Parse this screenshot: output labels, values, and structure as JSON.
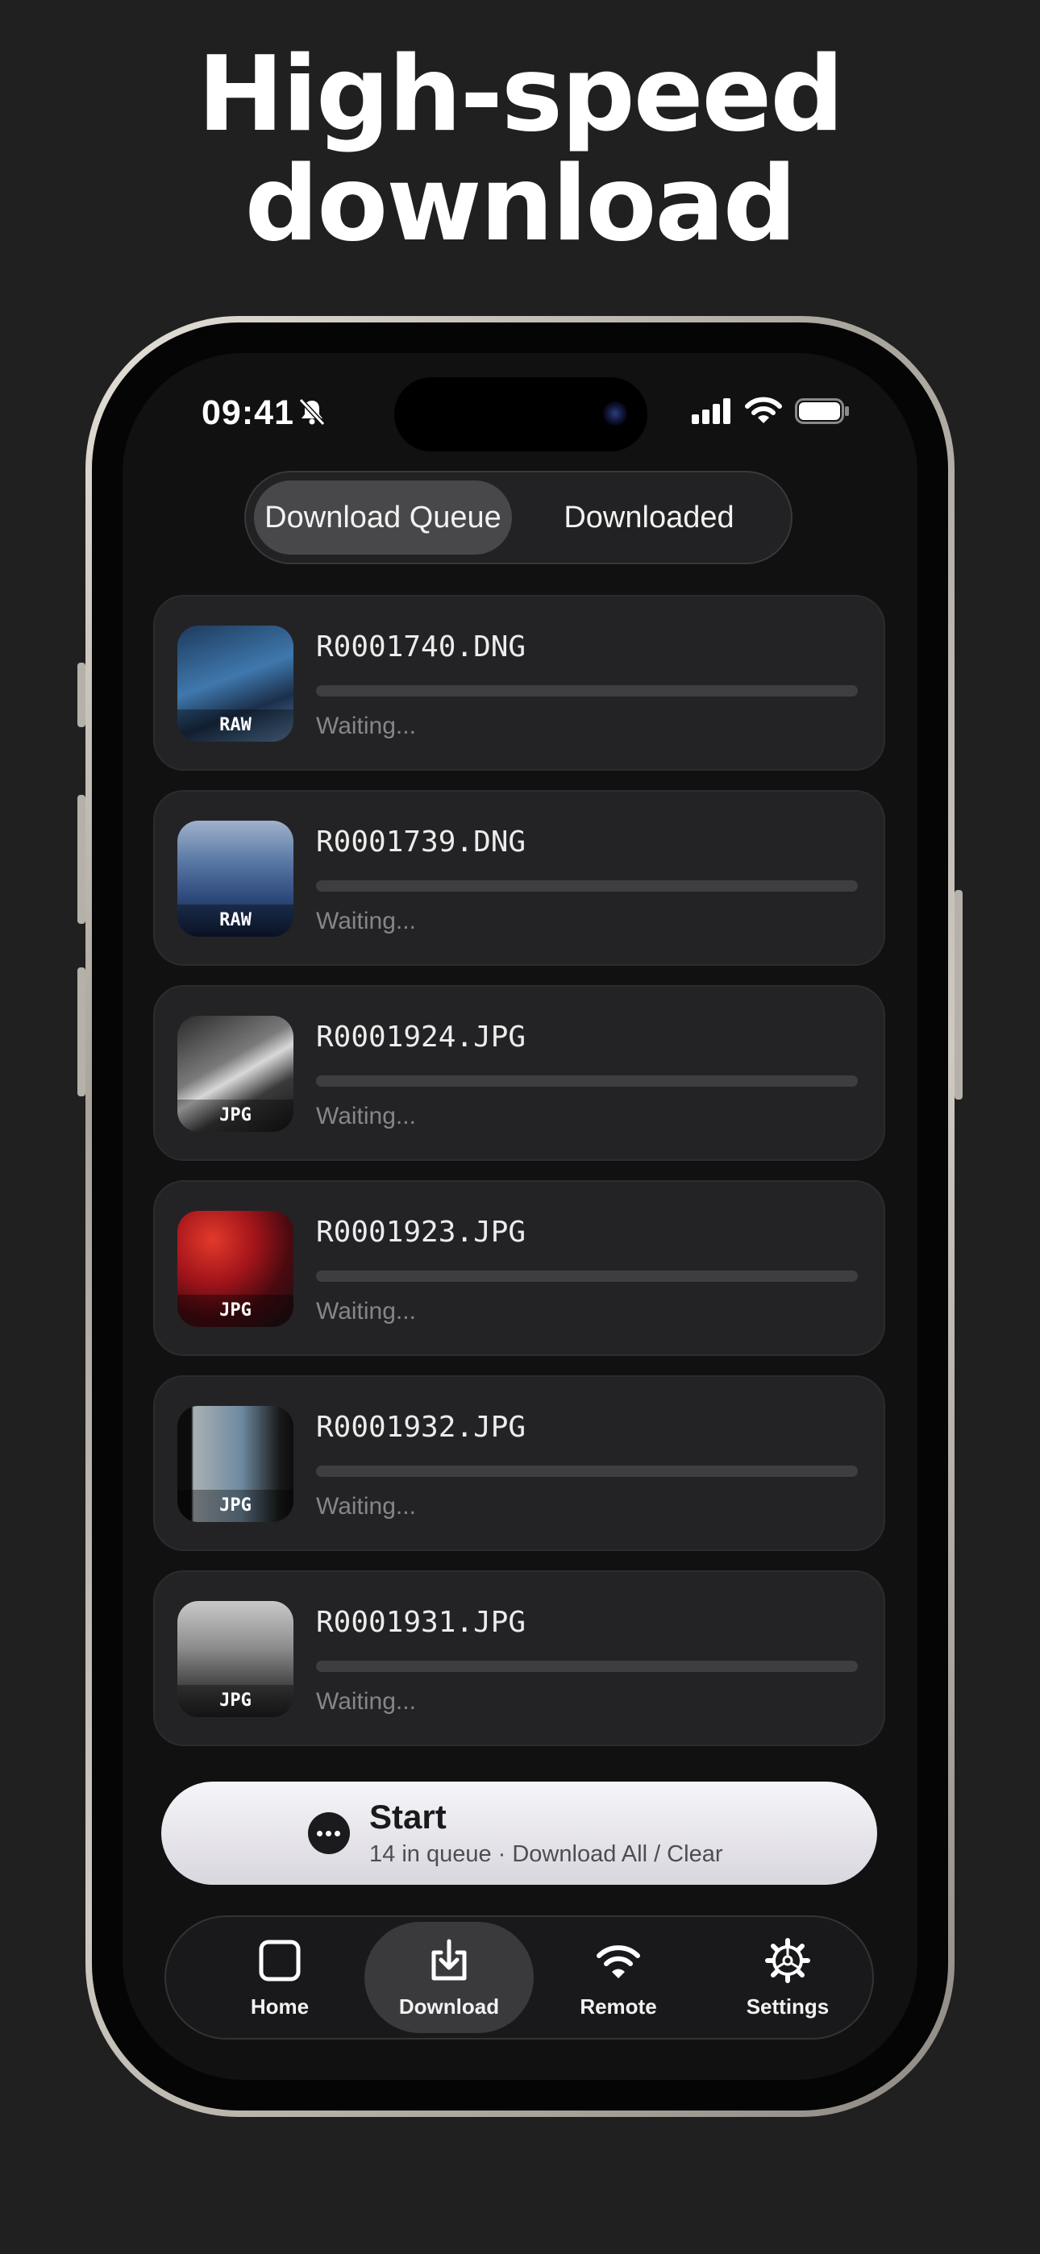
{
  "headline": {
    "line1": "High-speed",
    "line2": "download"
  },
  "status_bar": {
    "time": "09:41"
  },
  "segmented": {
    "queue": "Download Queue",
    "downloaded": "Downloaded",
    "selected": "Download Queue"
  },
  "queue": [
    {
      "name": "R0001740.DNG",
      "badge": "RAW",
      "status": "Waiting...",
      "progress": 0
    },
    {
      "name": "R0001739.DNG",
      "badge": "RAW",
      "status": "Waiting...",
      "progress": 0
    },
    {
      "name": "R0001924.JPG",
      "badge": "JPG",
      "status": "Waiting...",
      "progress": 0
    },
    {
      "name": "R0001923.JPG",
      "badge": "JPG",
      "status": "Waiting...",
      "progress": 0
    },
    {
      "name": "R0001932.JPG",
      "badge": "JPG",
      "status": "Waiting...",
      "progress": 0
    },
    {
      "name": "R0001931.JPG",
      "badge": "JPG",
      "status": "Waiting...",
      "progress": 0
    }
  ],
  "start_bar": {
    "title": "Start",
    "subtitle": "14 in queue · Download All / Clear",
    "icon": "more-icon"
  },
  "tabs": [
    {
      "label": "Home",
      "icon": "square-icon"
    },
    {
      "label": "Download",
      "icon": "download-tray-icon"
    },
    {
      "label": "Remote",
      "icon": "wifi-icon"
    },
    {
      "label": "Settings",
      "icon": "gear-icon"
    }
  ],
  "active_tab": "Download",
  "colors": {
    "background": "#202020",
    "card": "#232325",
    "accent_bar": "#f6f5f9"
  }
}
